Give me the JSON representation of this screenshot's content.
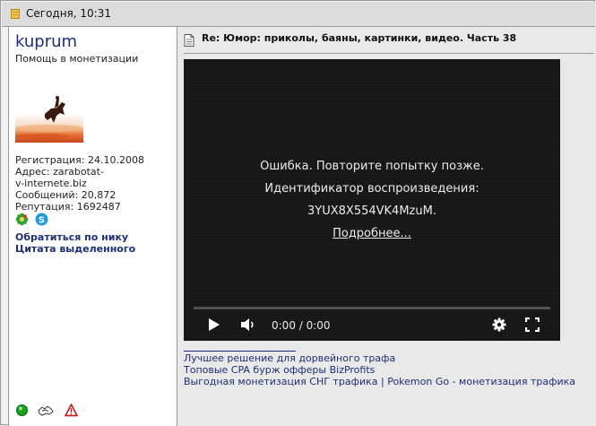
{
  "header": {
    "date": "Сегодня, 10:31"
  },
  "user": {
    "name": "kuprum",
    "title": "Помощь в монетизации",
    "registration": "Регистрация: 24.10.2008",
    "address_line1": "Адрес: zarabotat-",
    "address_line2": "v-internete.biz",
    "posts": "Сообщений: 20,872",
    "reputation": "Репутация: 1692487",
    "link_nick": "Обратиться по нику",
    "link_quote": "Цитата выделенного"
  },
  "post": {
    "title": "Re: Юмор: приколы, баяны, картинки, видео. Часть 38"
  },
  "video": {
    "error_line1": "Ошибка. Повторите попытку позже.",
    "error_line2": "Идентификатор воспроизведения:",
    "error_line3": "3YUX8X554VK4MzuM.",
    "more_link": "Подробнее...",
    "time": "0:00 / 0:00",
    "progress": 0
  },
  "promo_links": [
    "Лучшее решение для дорвейного трафа",
    "Топовые CPA бурж офферы BizProfits",
    "Выгодная монетизация СНГ трафика | Pokemon Go - монетизация трафика"
  ],
  "colors": {
    "link": "#1c2f74",
    "video_bg": "#151515",
    "panel_bg": "#ffffff",
    "content_bg": "#e9e9e9",
    "topbar_bg": "#dcdcdc"
  },
  "icons": {
    "post": "post-icon",
    "doc": "document-icon",
    "icq": "icq-icon",
    "skype": "skype-icon",
    "online": "online-status-icon",
    "reputation": "reputation-icon",
    "report": "report-icon",
    "play": "play-icon",
    "volume": "volume-icon",
    "settings": "settings-gear-icon",
    "fullscreen": "fullscreen-icon"
  }
}
